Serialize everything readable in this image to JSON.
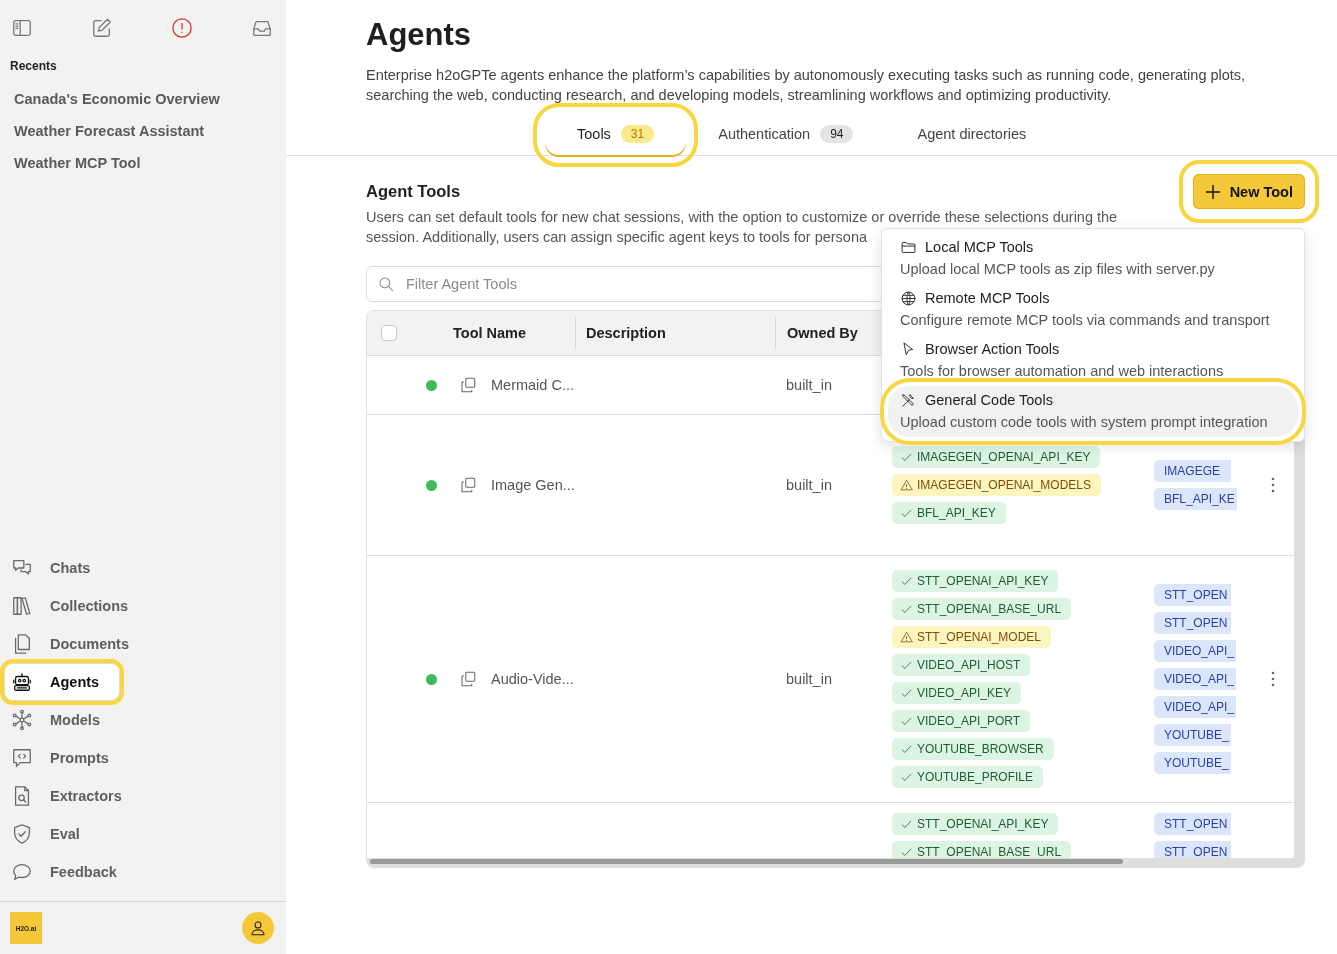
{
  "sidebar": {
    "recents_heading": "Recents",
    "recents": [
      "Canada's Economic Overview",
      "Weather Forecast Assistant",
      "Weather MCP Tool"
    ],
    "nav": [
      {
        "label": "Chats",
        "selected": false,
        "highlighted": false
      },
      {
        "label": "Collections",
        "selected": false,
        "highlighted": false
      },
      {
        "label": "Documents",
        "selected": false,
        "highlighted": false
      },
      {
        "label": "Agents",
        "selected": true,
        "highlighted": true
      },
      {
        "label": "Models",
        "selected": false,
        "highlighted": false
      },
      {
        "label": "Prompts",
        "selected": false,
        "highlighted": false
      },
      {
        "label": "Extractors",
        "selected": false,
        "highlighted": false
      },
      {
        "label": "Eval",
        "selected": false,
        "highlighted": false
      },
      {
        "label": "Feedback",
        "selected": false,
        "highlighted": false
      }
    ],
    "logo": "H2O.ai"
  },
  "page": {
    "title": "Agents",
    "description": "Enterprise h2oGPTe agents enhance the platform’s capabilities by autonomously executing tasks such as running code, generating plots, searching the web, conducting research, and developing models, streamlining workflows and optimizing productivity."
  },
  "tabs": [
    {
      "label": "Tools",
      "count": "31",
      "selected": true,
      "highlighted": true
    },
    {
      "label": "Authentication",
      "count": "94",
      "selected": false,
      "highlighted": false
    },
    {
      "label": "Agent directories",
      "selected": false,
      "highlighted": false
    }
  ],
  "section": {
    "title": "Agent Tools",
    "description_lines": [
      "Users can set default tools for new chat sessions, with the option to customize or override these selections during the",
      "session. Additionally, users can assign specific agent keys to tools for persona"
    ],
    "new_tool_button": {
      "label": "New Tool",
      "highlighted": true
    },
    "filter": {
      "placeholder": "Filter Agent Tools"
    }
  },
  "table": {
    "select_all": {
      "checked": false
    },
    "columns": [
      "Tool Name",
      "Description",
      "Owned By"
    ],
    "rows": [
      {
        "color": "#3dba5c",
        "name": "Mermaid C...",
        "owner": "built_in"
      },
      {
        "color": "#3dba5c",
        "name": "Image Gen...",
        "owner": "built_in",
        "menu": true,
        "keys": [
          {
            "name": "IMAGEGEN_OPENAI_API_KEY",
            "kind": "ok"
          },
          {
            "name": "IMAGEGEN_OPENAI_MODELS",
            "kind": "warning"
          },
          {
            "name": "BFL_API_KEY",
            "kind": "ok"
          }
        ],
        "assigned": [
          "IMAGEGE",
          "BFL_API_KE"
        ]
      },
      {
        "color": "#3dba5c",
        "name": "Audio-Vide...",
        "owner": "built_in",
        "menu": true,
        "keys": [
          {
            "name": "STT_OPENAI_API_KEY",
            "kind": "ok"
          },
          {
            "name": "STT_OPENAI_BASE_URL",
            "kind": "ok"
          },
          {
            "name": "STT_OPENAI_MODEL",
            "kind": "warning"
          },
          {
            "name": "VIDEO_API_HOST",
            "kind": "ok"
          },
          {
            "name": "VIDEO_API_KEY",
            "kind": "ok"
          },
          {
            "name": "VIDEO_API_PORT",
            "kind": "ok"
          },
          {
            "name": "YOUTUBE_BROWSER",
            "kind": "ok"
          },
          {
            "name": "YOUTUBE_PROFILE",
            "kind": "ok"
          }
        ],
        "assigned": [
          "STT_OPEN",
          "STT_OPEN",
          "VIDEO_API_",
          "VIDEO_API_",
          "VIDEO_API_",
          "YOUTUBE_",
          "YOUTUBE_"
        ]
      },
      {
        "keys": [
          {
            "name": "STT_OPENAI_API_KEY",
            "kind": "ok"
          },
          {
            "name": "STT_OPENAI_BASE_URL",
            "kind": "ok"
          }
        ],
        "assigned": [
          "STT_OPEN",
          "STT_OPEN"
        ]
      }
    ]
  },
  "new_tool_menu": [
    {
      "title": "Local MCP Tools",
      "description": "Upload local MCP tools as zip files with server.py",
      "highlighted": false
    },
    {
      "title": "Remote MCP Tools",
      "description": "Configure remote MCP tools via commands and transport",
      "highlighted": false
    },
    {
      "title": "Browser Action Tools",
      "description": "Tools for browser automation and web interactions",
      "highlighted": false
    },
    {
      "title": "General Code Tools",
      "description": "Upload custom code tools with system prompt integration",
      "highlighted": true
    }
  ]
}
